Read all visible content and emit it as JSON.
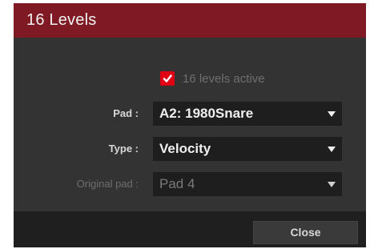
{
  "dialog": {
    "title": "16 Levels",
    "colors": {
      "titlebar": "#7f1a24",
      "body": "#333333",
      "footer": "#1f1f1f",
      "checkbox": "#e00016"
    }
  },
  "checkbox": {
    "label": "16 levels active",
    "checked": true
  },
  "fields": {
    "pad": {
      "label": "Pad :",
      "value": "A2: 1980Snare"
    },
    "type": {
      "label": "Type :",
      "value": "Velocity"
    },
    "original_pad": {
      "label": "Original pad :",
      "value": "Pad 4",
      "disabled": true
    }
  },
  "footer": {
    "close_label": "Close"
  },
  "icons": {
    "check": "checkmark-icon",
    "dropdown": "chevron-down-icon"
  }
}
